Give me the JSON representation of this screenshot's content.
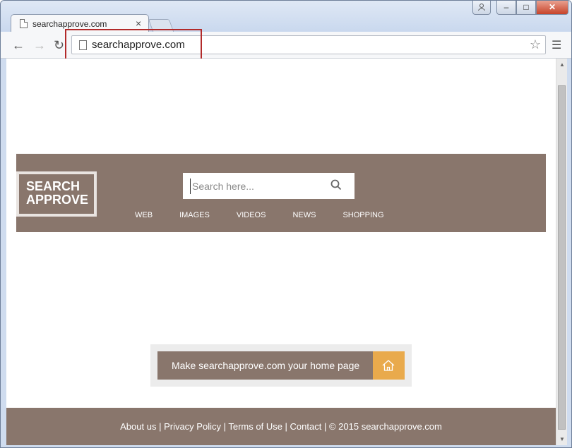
{
  "browser": {
    "tab_title": "searchapprove.com",
    "tab_close": "×",
    "url": "searchapprove.com",
    "window_controls": {
      "minimize": "–",
      "maximize": "□",
      "close": "✕"
    }
  },
  "header": {
    "logo_line1": "SEARCH",
    "logo_line2": "APPROVE",
    "search_placeholder": "Search here...",
    "nav": [
      "WEB",
      "IMAGES",
      "VIDEOS",
      "NEWS",
      "SHOPPING"
    ]
  },
  "homepage": {
    "label": "Make searchapprove.com your home page"
  },
  "footer": {
    "links": [
      "About us",
      "Privacy Policy",
      "Terms of Use",
      "Contact"
    ],
    "separator": " | ",
    "copyright": "© 2015 searchapprove.com"
  },
  "colors": {
    "brand": "#89766c",
    "accent": "#e9aa4c",
    "highlight": "#b22a2a"
  },
  "icons": {
    "search": "search-icon",
    "home": "home-icon",
    "star": "star-icon",
    "menu": "menu-icon"
  }
}
